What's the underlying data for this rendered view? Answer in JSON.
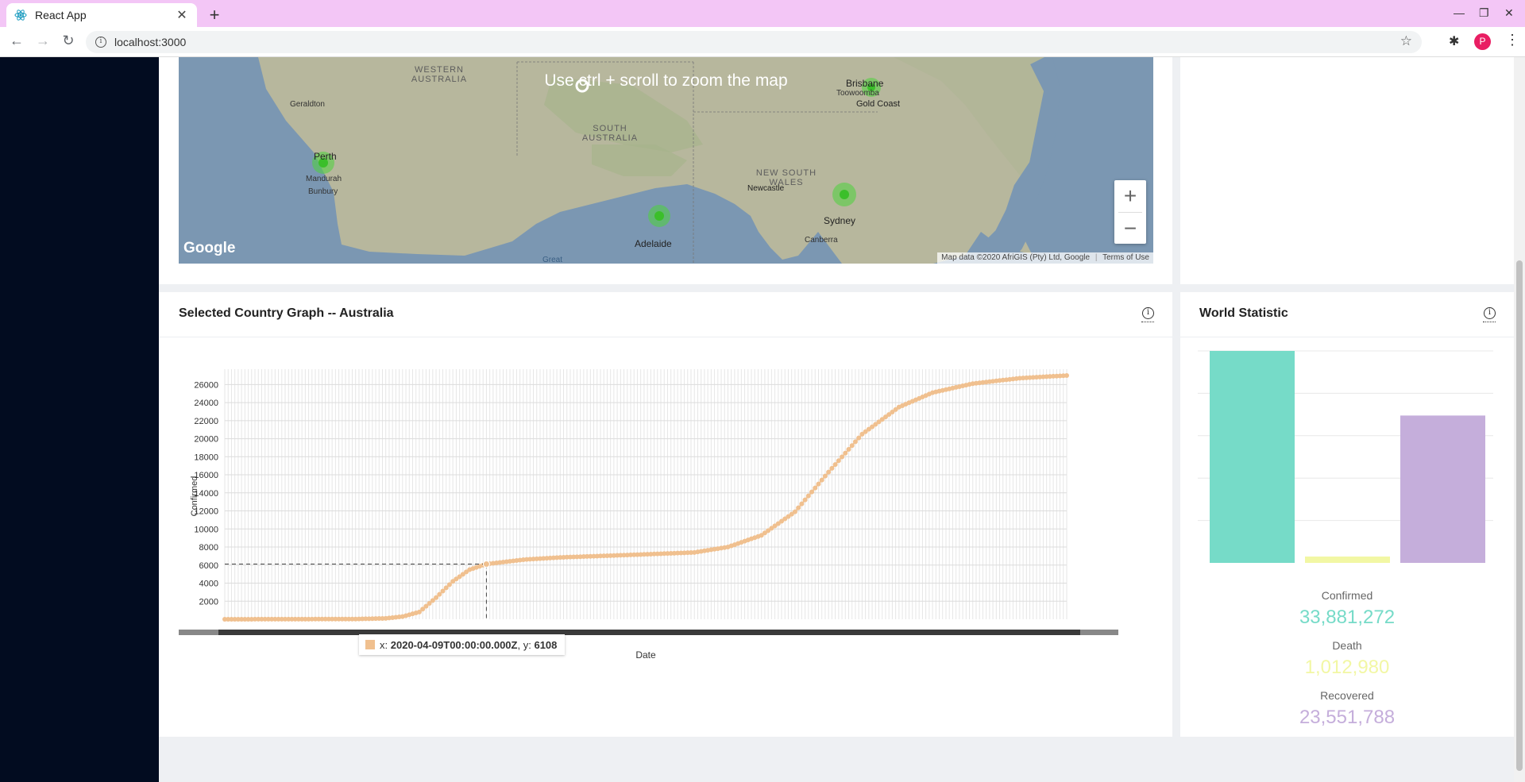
{
  "browser": {
    "tab_title": "React App",
    "url": "localhost:3000",
    "profile_initial": "P"
  },
  "map": {
    "overlay_text": "Use ctrl + scroll to zoom the map",
    "attribution": "Map data ©2020 AfriGIS (Pty) Ltd, Google",
    "terms": "Terms of Use",
    "logo": "Google",
    "labels": {
      "western_australia": "WESTERN AUSTRALIA",
      "south_australia": "SOUTH AUSTRALIA",
      "new_south_wales": "NEW SOUTH WALES",
      "geraldton": "Geraldton",
      "perth": "Perth",
      "mandurah": "Mandurah",
      "bunbury": "Bunbury",
      "adelaide": "Adelaide",
      "great": "Great",
      "brisbane": "Brisbane",
      "toowoomba": "Toowoomba",
      "gold_coast": "Gold Coast",
      "newcastle": "Newcastle",
      "sydney": "Sydney",
      "canberra": "Canberra"
    },
    "zoom_in": "+",
    "zoom_out": "−"
  },
  "graph": {
    "title": "Selected Country Graph -- Australia",
    "tooltip": {
      "x_label": "x:",
      "x_value": "2020-04-09T00:00:00.000Z",
      "y_label": "y:",
      "y_value": "6108"
    }
  },
  "chart_data": [
    {
      "type": "line",
      "xlabel": "Date",
      "ylabel": "Confirmed",
      "yticks": [
        2000,
        4000,
        6000,
        8000,
        10000,
        12000,
        14000,
        16000,
        18000,
        20000,
        22000,
        24000,
        26000
      ],
      "ylim": [
        0,
        27700
      ],
      "color": "#f0c08f",
      "series": [
        {
          "x": [
            "2020-01-22",
            "2020-02-15",
            "2020-03-01",
            "2020-03-10",
            "2020-03-15",
            "2020-03-20",
            "2020-03-25",
            "2020-03-30",
            "2020-04-04",
            "2020-04-09",
            "2020-04-20",
            "2020-05-01",
            "2020-05-20",
            "2020-06-10",
            "2020-06-20",
            "2020-06-30",
            "2020-07-10",
            "2020-07-20",
            "2020-07-30",
            "2020-08-10",
            "2020-08-20",
            "2020-09-01",
            "2020-09-15",
            "2020-09-29"
          ],
          "values": [
            0,
            15,
            25,
            100,
            300,
            800,
            2400,
            4200,
            5500,
            6108,
            6600,
            6850,
            7100,
            7400,
            8000,
            9300,
            11900,
            16300,
            20500,
            23500,
            25100,
            26100,
            26700,
            27000
          ]
        }
      ]
    },
    {
      "type": "bar",
      "categories": [
        "Confirmed",
        "Death",
        "Recovered"
      ],
      "values": [
        33881272,
        1012980,
        23551788
      ],
      "colors": [
        "#76dbc8",
        "#f2f7a4",
        "#c5aedb"
      ]
    }
  ],
  "stats": {
    "title": "World Statistic",
    "confirmed_label": "Confirmed",
    "confirmed_value": "33,881,272",
    "death_label": "Death",
    "death_value": "1,012,980",
    "recovered_label": "Recovered",
    "recovered_value": "23,551,788",
    "colors": {
      "confirmed": "#76dbc8",
      "death": "#f2f7a4",
      "recovered": "#c5aedb"
    }
  }
}
